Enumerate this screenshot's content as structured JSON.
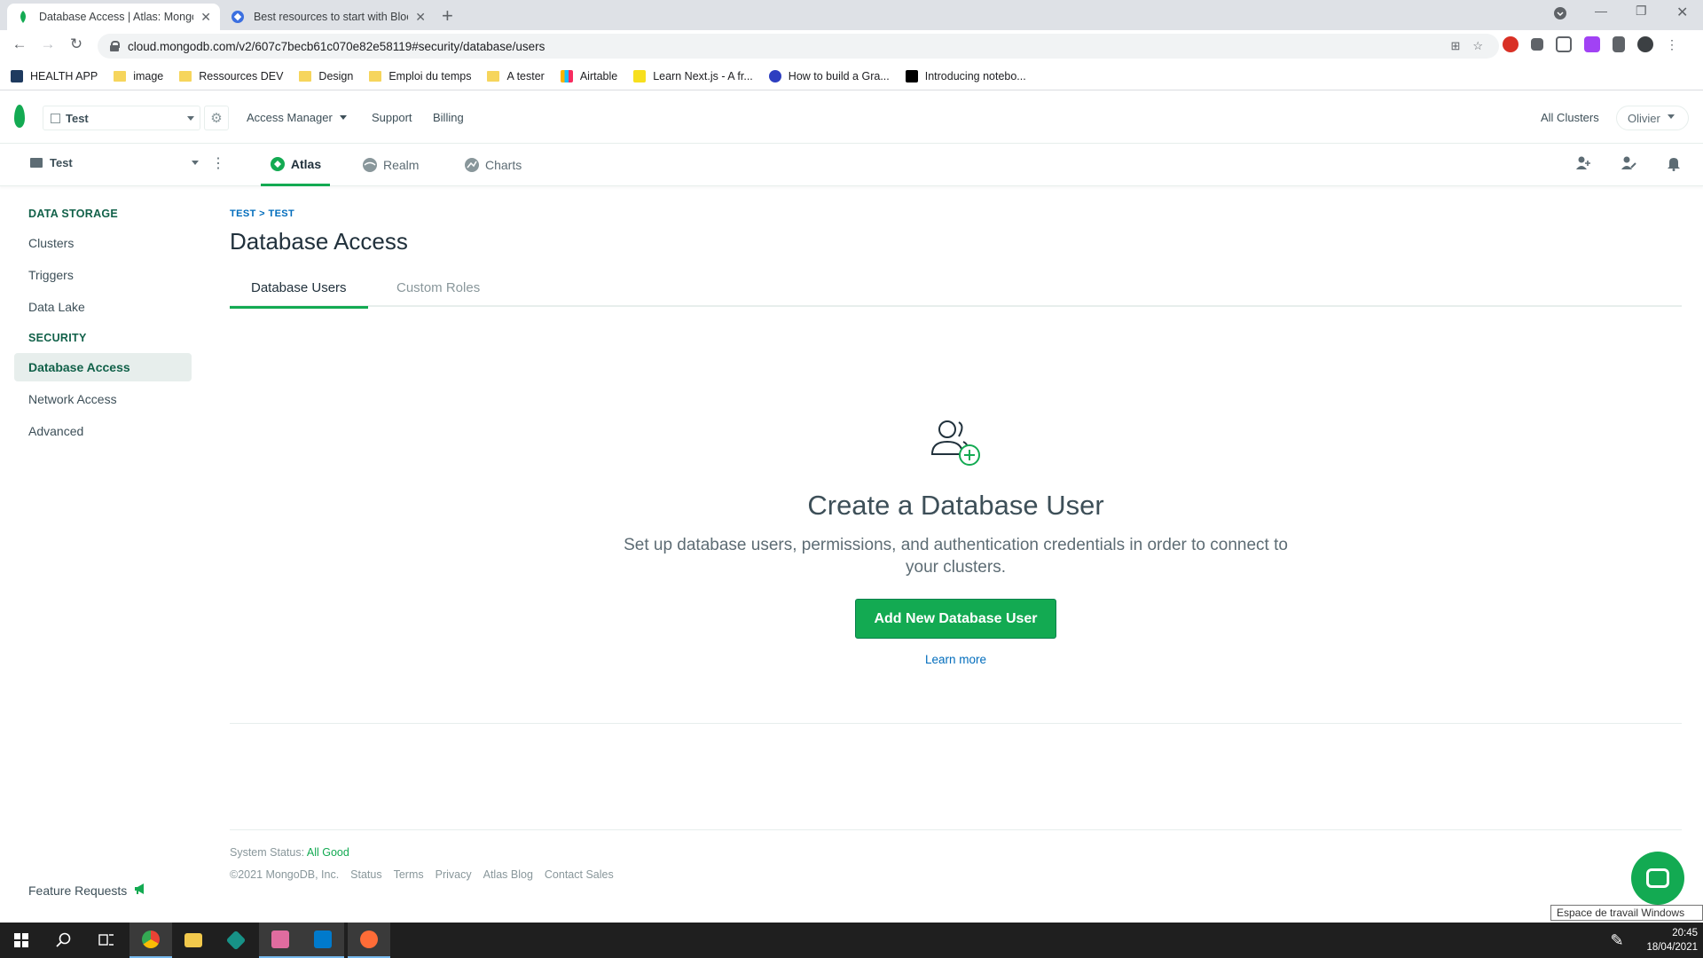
{
  "browser": {
    "tabs": [
      {
        "title": "Database Access | Atlas: MongoDB"
      },
      {
        "title": "Best resources to start with Blockchain"
      }
    ],
    "url": "cloud.mongodb.com/v2/607c7becb61c070e82e58119#security/database/users",
    "bookmarks": [
      {
        "label": "HEALTH APP",
        "icon": "app-icon"
      },
      {
        "label": "image",
        "icon": "folder-icon"
      },
      {
        "label": "Ressources DEV",
        "icon": "folder-icon"
      },
      {
        "label": "Design",
        "icon": "folder-icon"
      },
      {
        "label": "Emploi du temps",
        "icon": "folder-icon"
      },
      {
        "label": "A tester",
        "icon": "folder-icon"
      },
      {
        "label": "Airtable",
        "icon": "airtable-icon"
      },
      {
        "label": "Learn Next.js - A fr...",
        "icon": "js-icon"
      },
      {
        "label": "How to build a Gra...",
        "icon": "site-icon"
      },
      {
        "label": "Introducing notebo...",
        "icon": "medium-icon"
      }
    ]
  },
  "topnav": {
    "org": "Test",
    "access_manager": "Access Manager",
    "support": "Support",
    "billing": "Billing",
    "all_clusters": "All Clusters",
    "user": "Olivier"
  },
  "projnav": {
    "project": "Test",
    "tabs": [
      {
        "label": "Atlas"
      },
      {
        "label": "Realm"
      },
      {
        "label": "Charts"
      }
    ]
  },
  "sidebar": {
    "data_storage_heading": "DATA STORAGE",
    "data_storage_items": [
      "Clusters",
      "Triggers",
      "Data Lake"
    ],
    "security_heading": "SECURITY",
    "security_items": [
      "Database Access",
      "Network Access",
      "Advanced"
    ],
    "feature_requests": "Feature Requests"
  },
  "main": {
    "breadcrumb": "TEST > TEST",
    "title": "Database Access",
    "tabs": [
      "Database Users",
      "Custom Roles"
    ],
    "empty_title": "Create a Database User",
    "empty_desc": "Set up database users, permissions, and authentication credentials in order to connect to your clusters.",
    "add_button": "Add New Database User",
    "learn_more": "Learn more"
  },
  "footer": {
    "status_label": "System Status:",
    "status_value": "All Good",
    "copyright": "©2021 MongoDB, Inc.",
    "links": [
      "Status",
      "Terms",
      "Privacy",
      "Atlas Blog",
      "Contact Sales"
    ]
  },
  "tooltip": "Espace de travail Windows Ink",
  "taskbar": {
    "time": "20:45",
    "date": "18/04/2021"
  },
  "colors": {
    "brand_green": "#13aa52",
    "link_blue": "#006cbc",
    "text_dark": "#21313c"
  }
}
